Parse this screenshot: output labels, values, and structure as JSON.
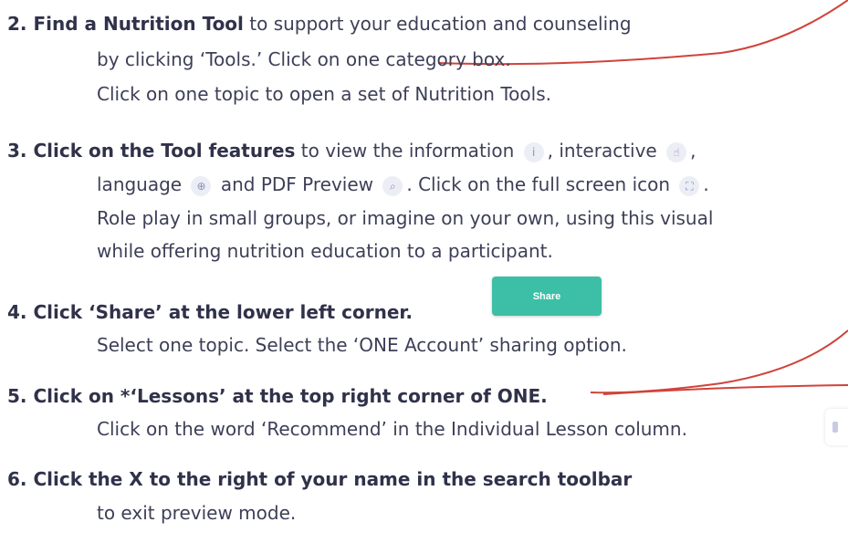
{
  "step2": {
    "bold": "2. Find a Nutrition Tool",
    "rest": " to support your education and counseling",
    "line2": "by clicking ‘Tools.’ Click on one category box.",
    "line3": "Click on one topic to open a set of Nutrition Tools."
  },
  "step3": {
    "bold": "3. Click on the Tool features",
    "a": " to view the information",
    "b": ", interactive",
    "c": ",",
    "d": "language",
    "e": "and PDF Preview",
    "f": ". Click on the full screen icon",
    "g": ".",
    "line3": "Role play in small groups, or imagine on your own, using this visual",
    "line4": "while offering nutrition education to a participant."
  },
  "step4": {
    "bold": "4. Click ‘Share’ at the lower left corner.",
    "line2": "Select one topic. Select the ‘ONE Account’ sharing option."
  },
  "share_button": {
    "label": "Share"
  },
  "step5": {
    "bold": "5. Click on *‘Lessons’ at the top right corner of ONE.",
    "line2": "Click on the word ‘Recommend’ in the Individual Lesson column."
  },
  "step6": {
    "bold": "6. Click the X to the right of your name in the search toolbar",
    "line2": "to exit preview mode."
  },
  "icons": {
    "info": "info-icon",
    "interactive": "pointer-hand-icon",
    "language": "globe-icon",
    "pdf": "pdf-preview-icon",
    "fullscreen": "fullscreen-icon"
  },
  "colors": {
    "accent": "#3cbfa6",
    "annotation": "#d0433b",
    "text": "#3d3f57"
  }
}
